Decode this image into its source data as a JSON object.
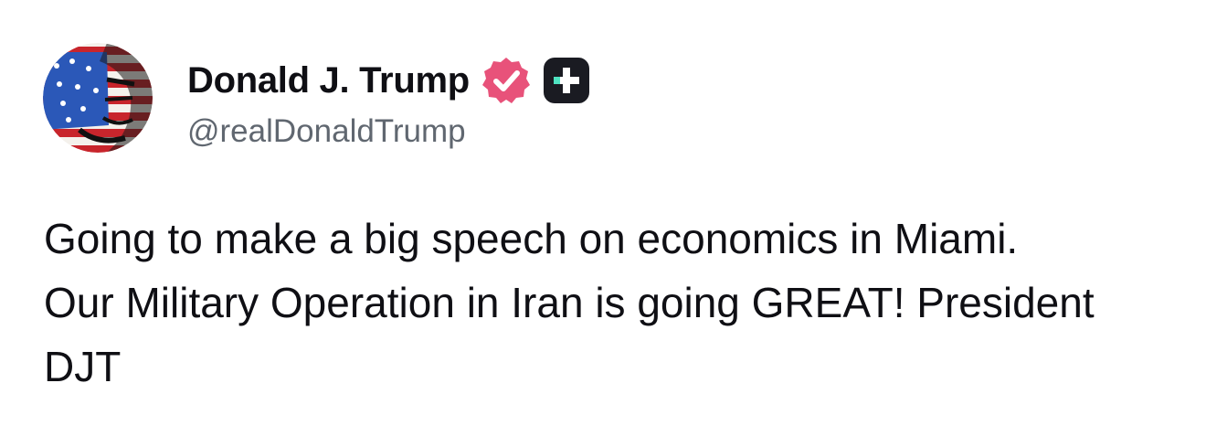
{
  "author": {
    "display_name": "Donald J. Trump",
    "handle": "@realDonaldTrump",
    "verified_icon": "verified-badge-icon",
    "plus_icon": "plus-badge-icon",
    "avatar_icon": "flag-portrait-avatar"
  },
  "post": {
    "text": "Going to make a big speech on economics in Miami. Our Military Operation in Iran is going GREAT! President DJT"
  },
  "colors": {
    "verified_badge": "#e8527a",
    "plus_badge": "#1a1b22",
    "plus_accent": "#4fe3c1",
    "handle_text": "#606770",
    "body_text": "#0f0f14"
  }
}
